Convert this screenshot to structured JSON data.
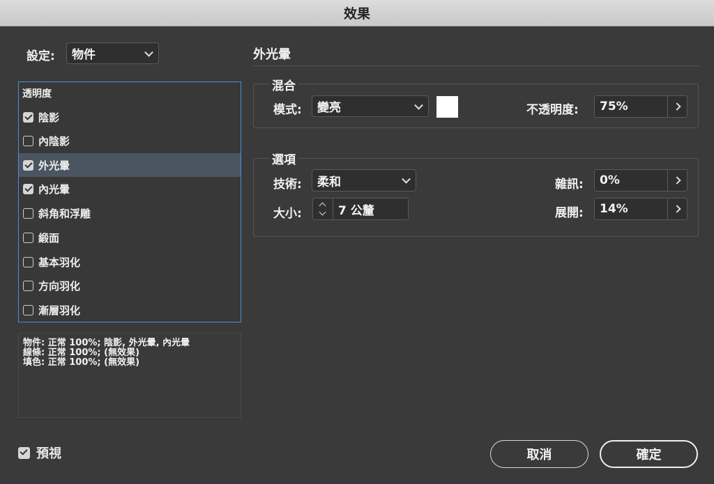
{
  "window": {
    "title": "效果"
  },
  "settings": {
    "label": "設定:",
    "value": "物件"
  },
  "effects_list": {
    "header": "透明度",
    "items": [
      {
        "label": "陰影",
        "checked": true,
        "selected": false
      },
      {
        "label": "內陰影",
        "checked": false,
        "selected": false
      },
      {
        "label": "外光暈",
        "checked": true,
        "selected": true
      },
      {
        "label": "內光暈",
        "checked": true,
        "selected": false
      },
      {
        "label": "斜角和浮雕",
        "checked": false,
        "selected": false
      },
      {
        "label": "緞面",
        "checked": false,
        "selected": false
      },
      {
        "label": "基本羽化",
        "checked": false,
        "selected": false
      },
      {
        "label": "方向羽化",
        "checked": false,
        "selected": false
      },
      {
        "label": "漸層羽化",
        "checked": false,
        "selected": false
      }
    ]
  },
  "summary": {
    "lines": [
      "物件: 正常 100%; 陰影, 外光暈, 內光暈",
      "線條: 正常 100%; (無效果)",
      "填色: 正常 100%; (無效果)"
    ]
  },
  "panel": {
    "title": "外光暈",
    "blend": {
      "title": "混合",
      "mode_label": "模式:",
      "mode_value": "變亮",
      "color": "#ffffff",
      "opacity_label": "不透明度:",
      "opacity_value": "75%"
    },
    "options": {
      "title": "選項",
      "technique_label": "技術:",
      "technique_value": "柔和",
      "size_label": "大小:",
      "size_value": "7 公釐",
      "noise_label": "雜訊:",
      "noise_value": "0%",
      "spread_label": "展開:",
      "spread_value": "14%"
    }
  },
  "footer": {
    "preview_label": "預視",
    "preview_checked": true,
    "cancel_label": "取消",
    "ok_label": "確定"
  }
}
